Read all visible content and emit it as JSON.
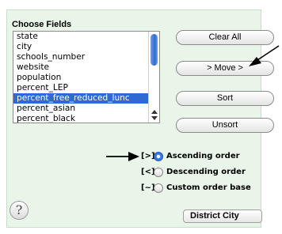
{
  "section_title": "Choose Fields",
  "fields": [
    {
      "label": "state",
      "selected": false
    },
    {
      "label": "city",
      "selected": false
    },
    {
      "label": "schools_number",
      "selected": false
    },
    {
      "label": "website",
      "selected": false
    },
    {
      "label": "population",
      "selected": false
    },
    {
      "label": "percent_LEP",
      "selected": false
    },
    {
      "label": "percent_free_reduced_lunc",
      "selected": true
    },
    {
      "label": "percent_asian",
      "selected": false
    },
    {
      "label": "percent_black",
      "selected": false
    }
  ],
  "buttons": {
    "clear_all": "Clear All",
    "move": "> Move >",
    "sort": "Sort",
    "unsort": "Unsort"
  },
  "sort_order": [
    {
      "key": "[>]",
      "label": "Ascending order",
      "checked": true
    },
    {
      "key": "[<]",
      "label": "Descending order",
      "checked": false
    },
    {
      "key": "[~]",
      "label": "Custom order base",
      "checked": false
    }
  ],
  "help": "?",
  "bottom_select": "District City",
  "colors": {
    "panel_bg": "#e8f5e8",
    "selection": "#2f6ad2"
  },
  "icons": {
    "help": "question-mark-icon",
    "annotation_arrow": "arrow-icon"
  }
}
